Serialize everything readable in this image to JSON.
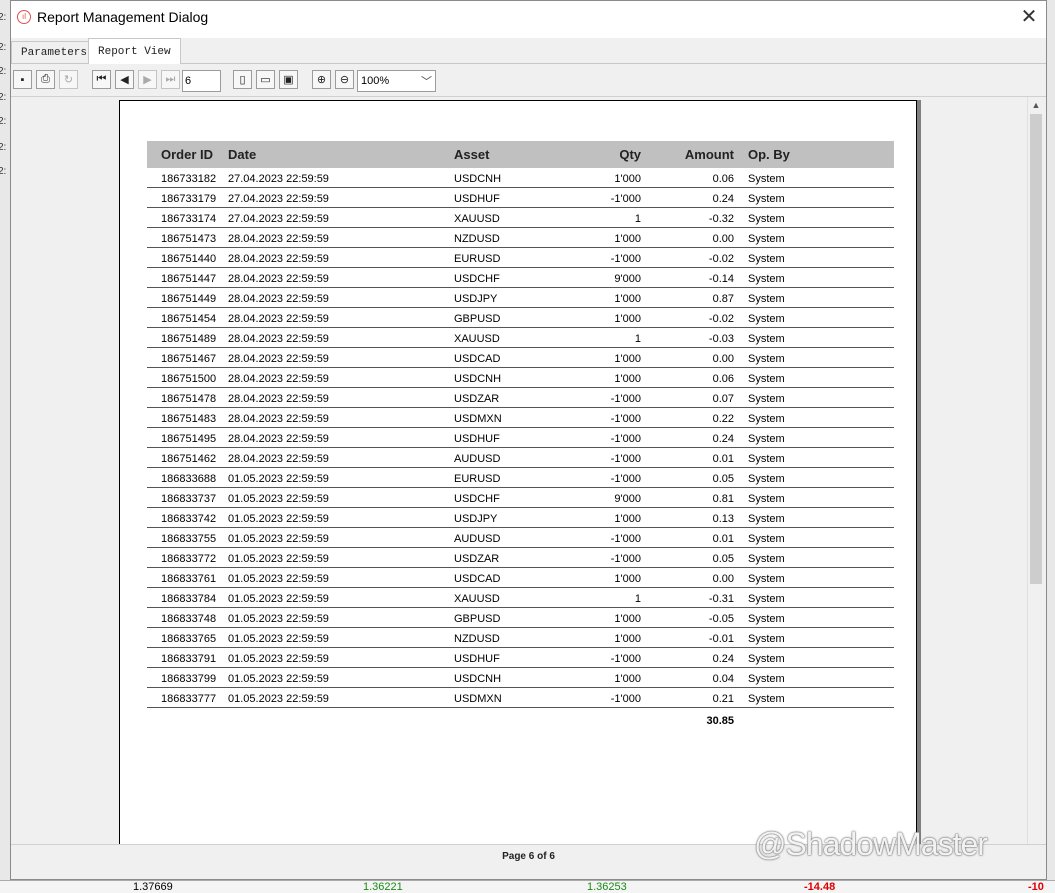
{
  "window": {
    "title": "Report Management Dialog"
  },
  "tabs": [
    "Parameters",
    "Report View"
  ],
  "toolbar": {
    "page_value": "6",
    "zoom_value": "100%"
  },
  "report": {
    "columns": [
      "Order ID",
      "Date",
      "Asset",
      "Qty",
      "Amount",
      "Op. By"
    ],
    "rows": [
      [
        "186733182",
        "27.04.2023 22:59:59",
        "USDCNH",
        "1'000",
        "0.06",
        "System"
      ],
      [
        "186733179",
        "27.04.2023 22:59:59",
        "USDHUF",
        "-1'000",
        "0.24",
        "System"
      ],
      [
        "186733174",
        "27.04.2023 22:59:59",
        "XAUUSD",
        "1",
        "-0.32",
        "System"
      ],
      [
        "186751473",
        "28.04.2023 22:59:59",
        "NZDUSD",
        "1'000",
        "0.00",
        "System"
      ],
      [
        "186751440",
        "28.04.2023 22:59:59",
        "EURUSD",
        "-1'000",
        "-0.02",
        "System"
      ],
      [
        "186751447",
        "28.04.2023 22:59:59",
        "USDCHF",
        "9'000",
        "-0.14",
        "System"
      ],
      [
        "186751449",
        "28.04.2023 22:59:59",
        "USDJPY",
        "1'000",
        "0.87",
        "System"
      ],
      [
        "186751454",
        "28.04.2023 22:59:59",
        "GBPUSD",
        "1'000",
        "-0.02",
        "System"
      ],
      [
        "186751489",
        "28.04.2023 22:59:59",
        "XAUUSD",
        "1",
        "-0.03",
        "System"
      ],
      [
        "186751467",
        "28.04.2023 22:59:59",
        "USDCAD",
        "1'000",
        "0.00",
        "System"
      ],
      [
        "186751500",
        "28.04.2023 22:59:59",
        "USDCNH",
        "1'000",
        "0.06",
        "System"
      ],
      [
        "186751478",
        "28.04.2023 22:59:59",
        "USDZAR",
        "-1'000",
        "0.07",
        "System"
      ],
      [
        "186751483",
        "28.04.2023 22:59:59",
        "USDMXN",
        "-1'000",
        "0.22",
        "System"
      ],
      [
        "186751495",
        "28.04.2023 22:59:59",
        "USDHUF",
        "-1'000",
        "0.24",
        "System"
      ],
      [
        "186751462",
        "28.04.2023 22:59:59",
        "AUDUSD",
        "-1'000",
        "0.01",
        "System"
      ],
      [
        "186833688",
        "01.05.2023 22:59:59",
        "EURUSD",
        "-1'000",
        "0.05",
        "System"
      ],
      [
        "186833737",
        "01.05.2023 22:59:59",
        "USDCHF",
        "9'000",
        "0.81",
        "System"
      ],
      [
        "186833742",
        "01.05.2023 22:59:59",
        "USDJPY",
        "1'000",
        "0.13",
        "System"
      ],
      [
        "186833755",
        "01.05.2023 22:59:59",
        "AUDUSD",
        "-1'000",
        "0.01",
        "System"
      ],
      [
        "186833772",
        "01.05.2023 22:59:59",
        "USDZAR",
        "-1'000",
        "0.05",
        "System"
      ],
      [
        "186833761",
        "01.05.2023 22:59:59",
        "USDCAD",
        "1'000",
        "0.00",
        "System"
      ],
      [
        "186833784",
        "01.05.2023 22:59:59",
        "XAUUSD",
        "1",
        "-0.31",
        "System"
      ],
      [
        "186833748",
        "01.05.2023 22:59:59",
        "GBPUSD",
        "1'000",
        "-0.05",
        "System"
      ],
      [
        "186833765",
        "01.05.2023 22:59:59",
        "NZDUSD",
        "1'000",
        "-0.01",
        "System"
      ],
      [
        "186833791",
        "01.05.2023 22:59:59",
        "USDHUF",
        "-1'000",
        "0.24",
        "System"
      ],
      [
        "186833799",
        "01.05.2023 22:59:59",
        "USDCNH",
        "1'000",
        "0.04",
        "System"
      ],
      [
        "186833777",
        "01.05.2023 22:59:59",
        "USDMXN",
        "-1'000",
        "0.21",
        "System"
      ]
    ],
    "total_amount": "30.85"
  },
  "status": {
    "page_label": "Page 6 of 6"
  },
  "watermark": "@ShadowMaster",
  "background_fragments": {
    "bottom_values": [
      "1.37669",
      "1.36221",
      "1.36253",
      "-14.48",
      "-10"
    ]
  },
  "colors": {
    "header_gray": "#c0c0c0",
    "accent_red": "#d9534f",
    "bg": "#f0f0f0"
  }
}
